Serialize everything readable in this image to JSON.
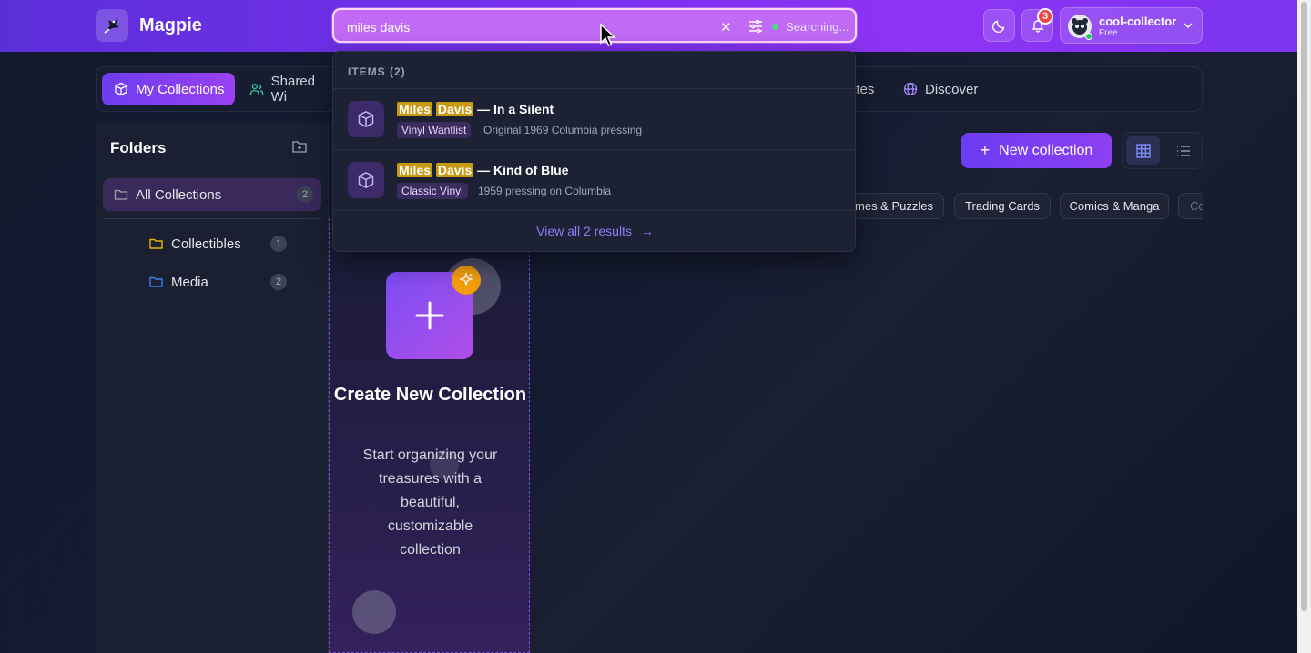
{
  "app": {
    "title": "Magpie"
  },
  "search": {
    "value": "miles davis",
    "status": "Searching..."
  },
  "notifications": {
    "count": "3"
  },
  "user": {
    "name": "cool-collector",
    "plan": "Free"
  },
  "tabs": [
    {
      "label": "My Collections"
    },
    {
      "label": "Shared Wi"
    },
    {
      "label": "ates"
    },
    {
      "label": "Discover"
    }
  ],
  "sidebar": {
    "title": "Folders",
    "items": [
      {
        "label": "All Collections",
        "count": "2"
      },
      {
        "label": "Collectibles",
        "count": "1"
      },
      {
        "label": "Media",
        "count": "2"
      }
    ]
  },
  "toolbar": {
    "new_collection": "New collection"
  },
  "chips": [
    {
      "label": "mes & Puzzles"
    },
    {
      "label": "Trading Cards"
    },
    {
      "label": "Comics & Manga"
    },
    {
      "label": "Co"
    }
  ],
  "create_card": {
    "title": "Create New Collection",
    "description": "Start organizing your treasures with a beautiful, customizable collection"
  },
  "dropdown": {
    "header": "ITEMS (2)",
    "results": [
      {
        "hl1": "Miles",
        "hl2": "Davis",
        "rest": " — In a Silent",
        "tag": "Vinyl Wantlist",
        "sub": "Original 1969 Columbia pressing"
      },
      {
        "hl1": "Miles",
        "hl2": "Davis",
        "rest": " — Kind of Blue",
        "tag": "Classic Vinyl",
        "sub": "1959 pressing on Columbia"
      }
    ],
    "view_all": "View all 2 results"
  },
  "colors": {
    "accent": "#7b2ff0",
    "highlight": "#c79a12",
    "folder_yellow": "#eab308",
    "folder_blue": "#3b82f6"
  }
}
